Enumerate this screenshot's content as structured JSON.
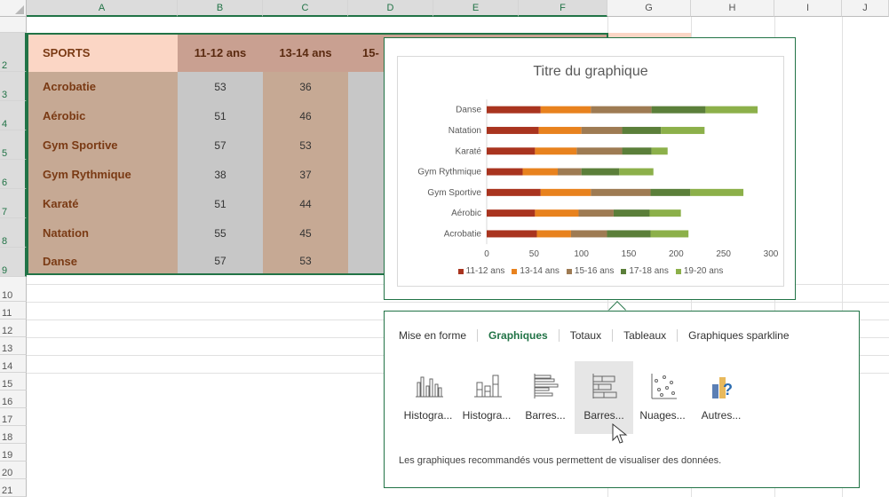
{
  "columns": [
    "A",
    "B",
    "C",
    "D",
    "E",
    "F",
    "G",
    "H",
    "I",
    "J"
  ],
  "rows": [
    "2",
    "3",
    "4",
    "5",
    "6",
    "7",
    "8",
    "9",
    "10",
    "11",
    "12",
    "13",
    "14",
    "15",
    "16",
    "17",
    "18",
    "19",
    "20",
    "21"
  ],
  "table": {
    "header": {
      "label": "SPORTS",
      "ages": [
        "11-12 ans",
        "13-14 ans",
        "15-"
      ]
    },
    "rows": [
      {
        "sport": "Acrobatie",
        "a": "53",
        "b": "36"
      },
      {
        "sport": "Aérobic",
        "a": "51",
        "b": "46"
      },
      {
        "sport": "Gym Sportive",
        "a": "57",
        "b": "53"
      },
      {
        "sport": "Gym Rythmique",
        "a": "38",
        "b": "37"
      },
      {
        "sport": "Karaté",
        "a": "51",
        "b": "44"
      },
      {
        "sport": "Natation",
        "a": "55",
        "b": "45"
      },
      {
        "sport": "Danse",
        "a": "57",
        "b": "53"
      }
    ]
  },
  "chart_data": {
    "type": "bar",
    "title": "Titre du graphique",
    "categories": [
      "Danse",
      "Natation",
      "Karaté",
      "Gym Rythmique",
      "Gym Sportive",
      "Aérobic",
      "Acrobatie"
    ],
    "series": [
      {
        "name": "11-12 ans",
        "color": "#a9341f",
        "values": [
          57,
          55,
          51,
          38,
          57,
          51,
          53
        ]
      },
      {
        "name": "13-14 ans",
        "color": "#e8821e",
        "values": [
          53,
          45,
          44,
          37,
          53,
          46,
          36
        ]
      },
      {
        "name": "15-16 ans",
        "color": "#9e7b53",
        "values": [
          64,
          43,
          48,
          25,
          63,
          37,
          38
        ]
      },
      {
        "name": "17-18 ans",
        "color": "#5b7f3a",
        "values": [
          57,
          41,
          31,
          40,
          42,
          38,
          46
        ]
      },
      {
        "name": "19-20 ans",
        "color": "#8cb04a",
        "values": [
          55,
          46,
          17,
          36,
          56,
          33,
          40
        ]
      }
    ],
    "xticks": [
      "0",
      "50",
      "100",
      "150",
      "200",
      "250",
      "300"
    ],
    "xlim": [
      0,
      300
    ],
    "legend": "bottom"
  },
  "quick_analysis": {
    "tabs": [
      "Mise en forme",
      "Graphiques",
      "Totaux",
      "Tableaux",
      "Graphiques sparkline"
    ],
    "active_tab": "Graphiques",
    "items": [
      "Histogra...",
      "Histogra...",
      "Barres...",
      "Barres...",
      "Nuages...",
      "Autres..."
    ],
    "description": "Les graphiques recommandés vous permettent de visualiser des données."
  }
}
